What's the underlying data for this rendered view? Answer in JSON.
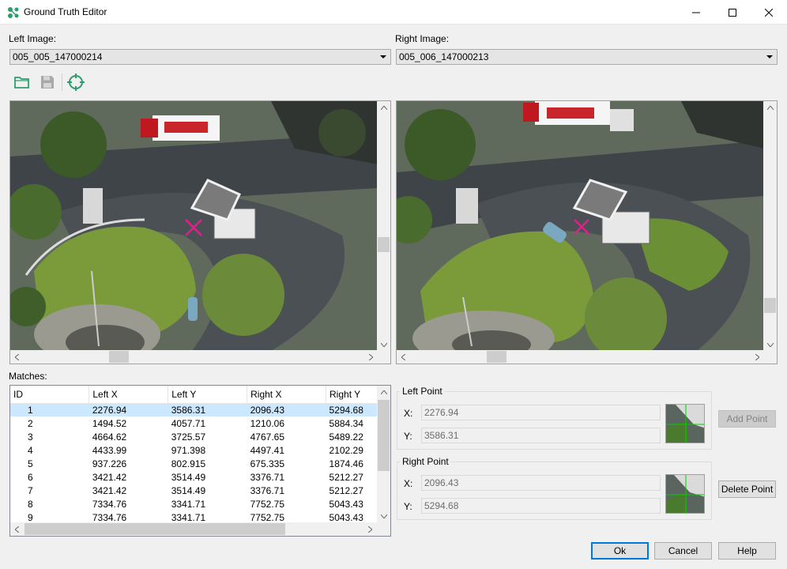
{
  "window": {
    "title": "Ground Truth Editor",
    "icon": "ground-truth-app-icon"
  },
  "left_image": {
    "label": "Left Image:",
    "selected": "005_005_147000214"
  },
  "right_image": {
    "label": "Right Image:",
    "selected": "005_006_147000213"
  },
  "toolbar": {
    "icons": [
      "folder-open-icon",
      "save-icon",
      "crosshair-icon"
    ],
    "accent": "#2e9e6e"
  },
  "matches": {
    "label": "Matches:",
    "columns": [
      "ID",
      "Left X",
      "Left Y",
      "Right X",
      "Right Y"
    ],
    "rows": [
      [
        "1",
        "2276.94",
        "3586.31",
        "2096.43",
        "5294.68"
      ],
      [
        "2",
        "1494.52",
        "4057.71",
        "1210.06",
        "5884.34"
      ],
      [
        "3",
        "4664.62",
        "3725.57",
        "4767.65",
        "5489.22"
      ],
      [
        "4",
        "4433.99",
        "971.398",
        "4497.41",
        "2102.29"
      ],
      [
        "5",
        "937.226",
        "802.915",
        "675.335",
        "1874.46"
      ],
      [
        "6",
        "3421.42",
        "3514.49",
        "3376.71",
        "5212.27"
      ],
      [
        "7",
        "3421.42",
        "3514.49",
        "3376.71",
        "5212.27"
      ],
      [
        "8",
        "7334.76",
        "3341.71",
        "7752.75",
        "5043.43"
      ],
      [
        "9",
        "7334.76",
        "3341.71",
        "7752.75",
        "5043.43"
      ]
    ],
    "selected_row": 0,
    "selection_color": "#cce8ff"
  },
  "left_point": {
    "title": "Left Point",
    "x_label": "X:",
    "x_value": "2276.94",
    "y_label": "Y:",
    "y_value": "3586.31"
  },
  "right_point": {
    "title": "Right Point",
    "x_label": "X:",
    "x_value": "2096.43",
    "y_label": "Y:",
    "y_value": "5294.68"
  },
  "buttons": {
    "add_point": "Add Point",
    "delete_point": "Delete Point",
    "ok": "Ok",
    "cancel": "Cancel",
    "help": "Help"
  },
  "marker_color": "#e0208a",
  "crosshair_color": "#00d000"
}
